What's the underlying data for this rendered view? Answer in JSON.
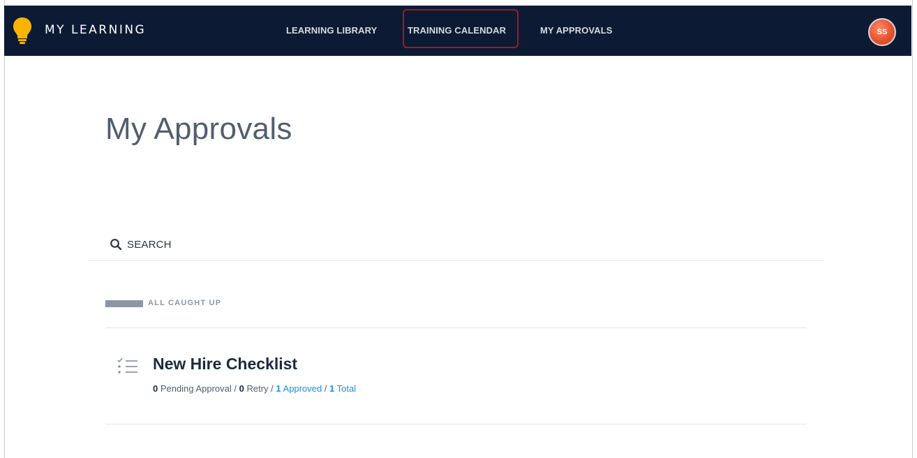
{
  "header": {
    "brand": "MY LEARNING",
    "nav": [
      {
        "label": "LEARNING LIBRARY"
      },
      {
        "label": "TRAINING CALENDAR",
        "highlighted": true
      },
      {
        "label": "MY APPROVALS"
      }
    ],
    "avatar_initials": "SS",
    "background_color": "#0d1a33",
    "highlight_color": "#a01a24"
  },
  "main": {
    "title": "My Approvals",
    "search": {
      "label": "SEARCH",
      "icon": "search-icon"
    },
    "group": {
      "label": "ALL CAUGHT UP",
      "items": [
        {
          "icon": "checklist-icon",
          "title": "New Hire Checklist",
          "stats": {
            "pending_count": "0",
            "pending_label": "Pending Approval",
            "retry_count": "0",
            "retry_label": "Retry",
            "approved_count": "1",
            "approved_label": "Approved",
            "total_count": "1",
            "total_label": "Total",
            "separator": " / "
          }
        }
      ]
    }
  },
  "colors": {
    "link_blue": "#1a8fe0",
    "muted_gray": "#8c96a5"
  }
}
